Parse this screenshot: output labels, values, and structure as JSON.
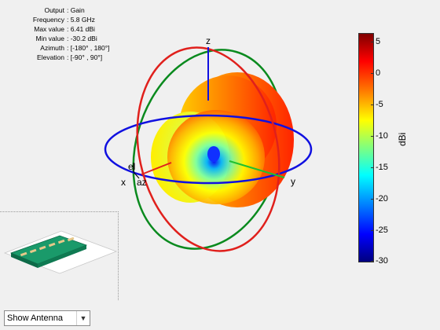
{
  "info": {
    "rows": [
      {
        "key": "Output",
        "value": ": Gain"
      },
      {
        "key": "Frequency",
        "value": ": 5.8 GHz"
      },
      {
        "key": "Max value",
        "value": ": 6.41 dBi"
      },
      {
        "key": "Min value",
        "value": ": -30.2 dBi"
      },
      {
        "key": "Azimuth",
        "value": ": [-180° , 180°]"
      },
      {
        "key": "Elevation",
        "value": ": [-90° , 90°]"
      }
    ]
  },
  "axes": {
    "z": "z",
    "y": "y",
    "x": "x",
    "el": "el",
    "az": "az"
  },
  "colorbar": {
    "label": "dBi",
    "ticks": [
      "5",
      "0",
      "-5",
      "-10",
      "-15",
      "-20",
      "-25",
      "-30"
    ],
    "tick_values": [
      5,
      0,
      -5,
      -10,
      -15,
      -20,
      -25,
      -30
    ],
    "min": -30.2,
    "max": 6.41
  },
  "colors": {
    "x_circle": "#e0201c",
    "y_circle": "#0a8a1e",
    "z_circle": "#1010e0"
  },
  "antenna_view": {
    "dropdown_value": "Show Antenna"
  }
}
